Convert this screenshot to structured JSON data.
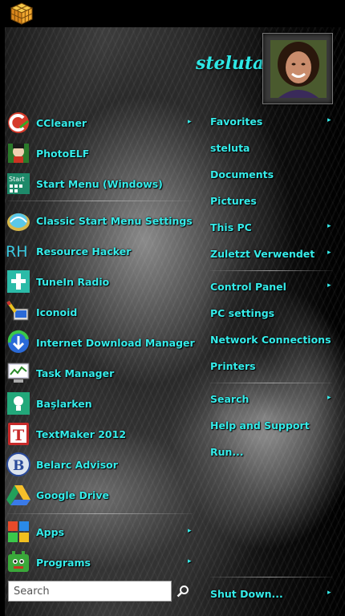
{
  "user": {
    "name": "steluta"
  },
  "left_items": [
    {
      "id": "ccleaner",
      "label": "CCleaner",
      "has_arrow": true
    },
    {
      "id": "photoelf",
      "label": "PhotoELF",
      "has_arrow": false
    },
    {
      "id": "start-menu-windows",
      "label": "Start Menu (Windows)",
      "has_arrow": false
    },
    {
      "id": "classic-start-menu-settings",
      "label": "Classic Start Menu Settings",
      "has_arrow": false
    },
    {
      "id": "resource-hacker",
      "label": "Resource Hacker",
      "has_arrow": false
    },
    {
      "id": "tunein-radio",
      "label": "TuneIn Radio",
      "has_arrow": false
    },
    {
      "id": "iconoid",
      "label": "Iconoid",
      "has_arrow": false
    },
    {
      "id": "internet-download-manager",
      "label": "Internet Download Manager",
      "has_arrow": false
    },
    {
      "id": "task-manager",
      "label": "Task Manager",
      "has_arrow": false
    },
    {
      "id": "baslarken",
      "label": "Başlarken",
      "has_arrow": false
    },
    {
      "id": "textmaker-2012",
      "label": "TextMaker 2012",
      "has_arrow": false
    },
    {
      "id": "belarc-advisor",
      "label": "Belarc Advisor",
      "has_arrow": false
    },
    {
      "id": "google-drive",
      "label": "Google Drive",
      "has_arrow": false
    }
  ],
  "bottom_left_items": [
    {
      "id": "apps",
      "label": "Apps",
      "has_arrow": true
    },
    {
      "id": "programs",
      "label": "Programs",
      "has_arrow": true
    }
  ],
  "right_items": [
    {
      "id": "favorites",
      "label": "Favorites",
      "has_arrow": true
    },
    {
      "id": "steluta",
      "label": "steluta",
      "has_arrow": false
    },
    {
      "id": "documents",
      "label": "Documents",
      "has_arrow": false
    },
    {
      "id": "pictures",
      "label": "Pictures",
      "has_arrow": false
    },
    {
      "id": "this-pc",
      "label": "This PC",
      "has_arrow": true
    },
    {
      "id": "zuletzt-verwendet",
      "label": "Zuletzt Verwendet",
      "has_arrow": true
    },
    {
      "id": "control-panel",
      "label": "Control Panel",
      "has_arrow": true
    },
    {
      "id": "pc-settings",
      "label": "PC settings",
      "has_arrow": false
    },
    {
      "id": "network-connections",
      "label": "Network Connections",
      "has_arrow": false
    },
    {
      "id": "printers",
      "label": "Printers",
      "has_arrow": false
    },
    {
      "id": "search",
      "label": "Search",
      "has_arrow": true
    },
    {
      "id": "help-and-support",
      "label": "Help and Support",
      "has_arrow": false
    },
    {
      "id": "run",
      "label": "Run...",
      "has_arrow": false
    }
  ],
  "shutdown": {
    "label": "Shut Down...",
    "has_arrow": true
  },
  "search": {
    "placeholder": "Search",
    "value": ""
  },
  "colors": {
    "accent_text": "#35ecea",
    "background": "#000000"
  },
  "arrow_glyph": "▸"
}
